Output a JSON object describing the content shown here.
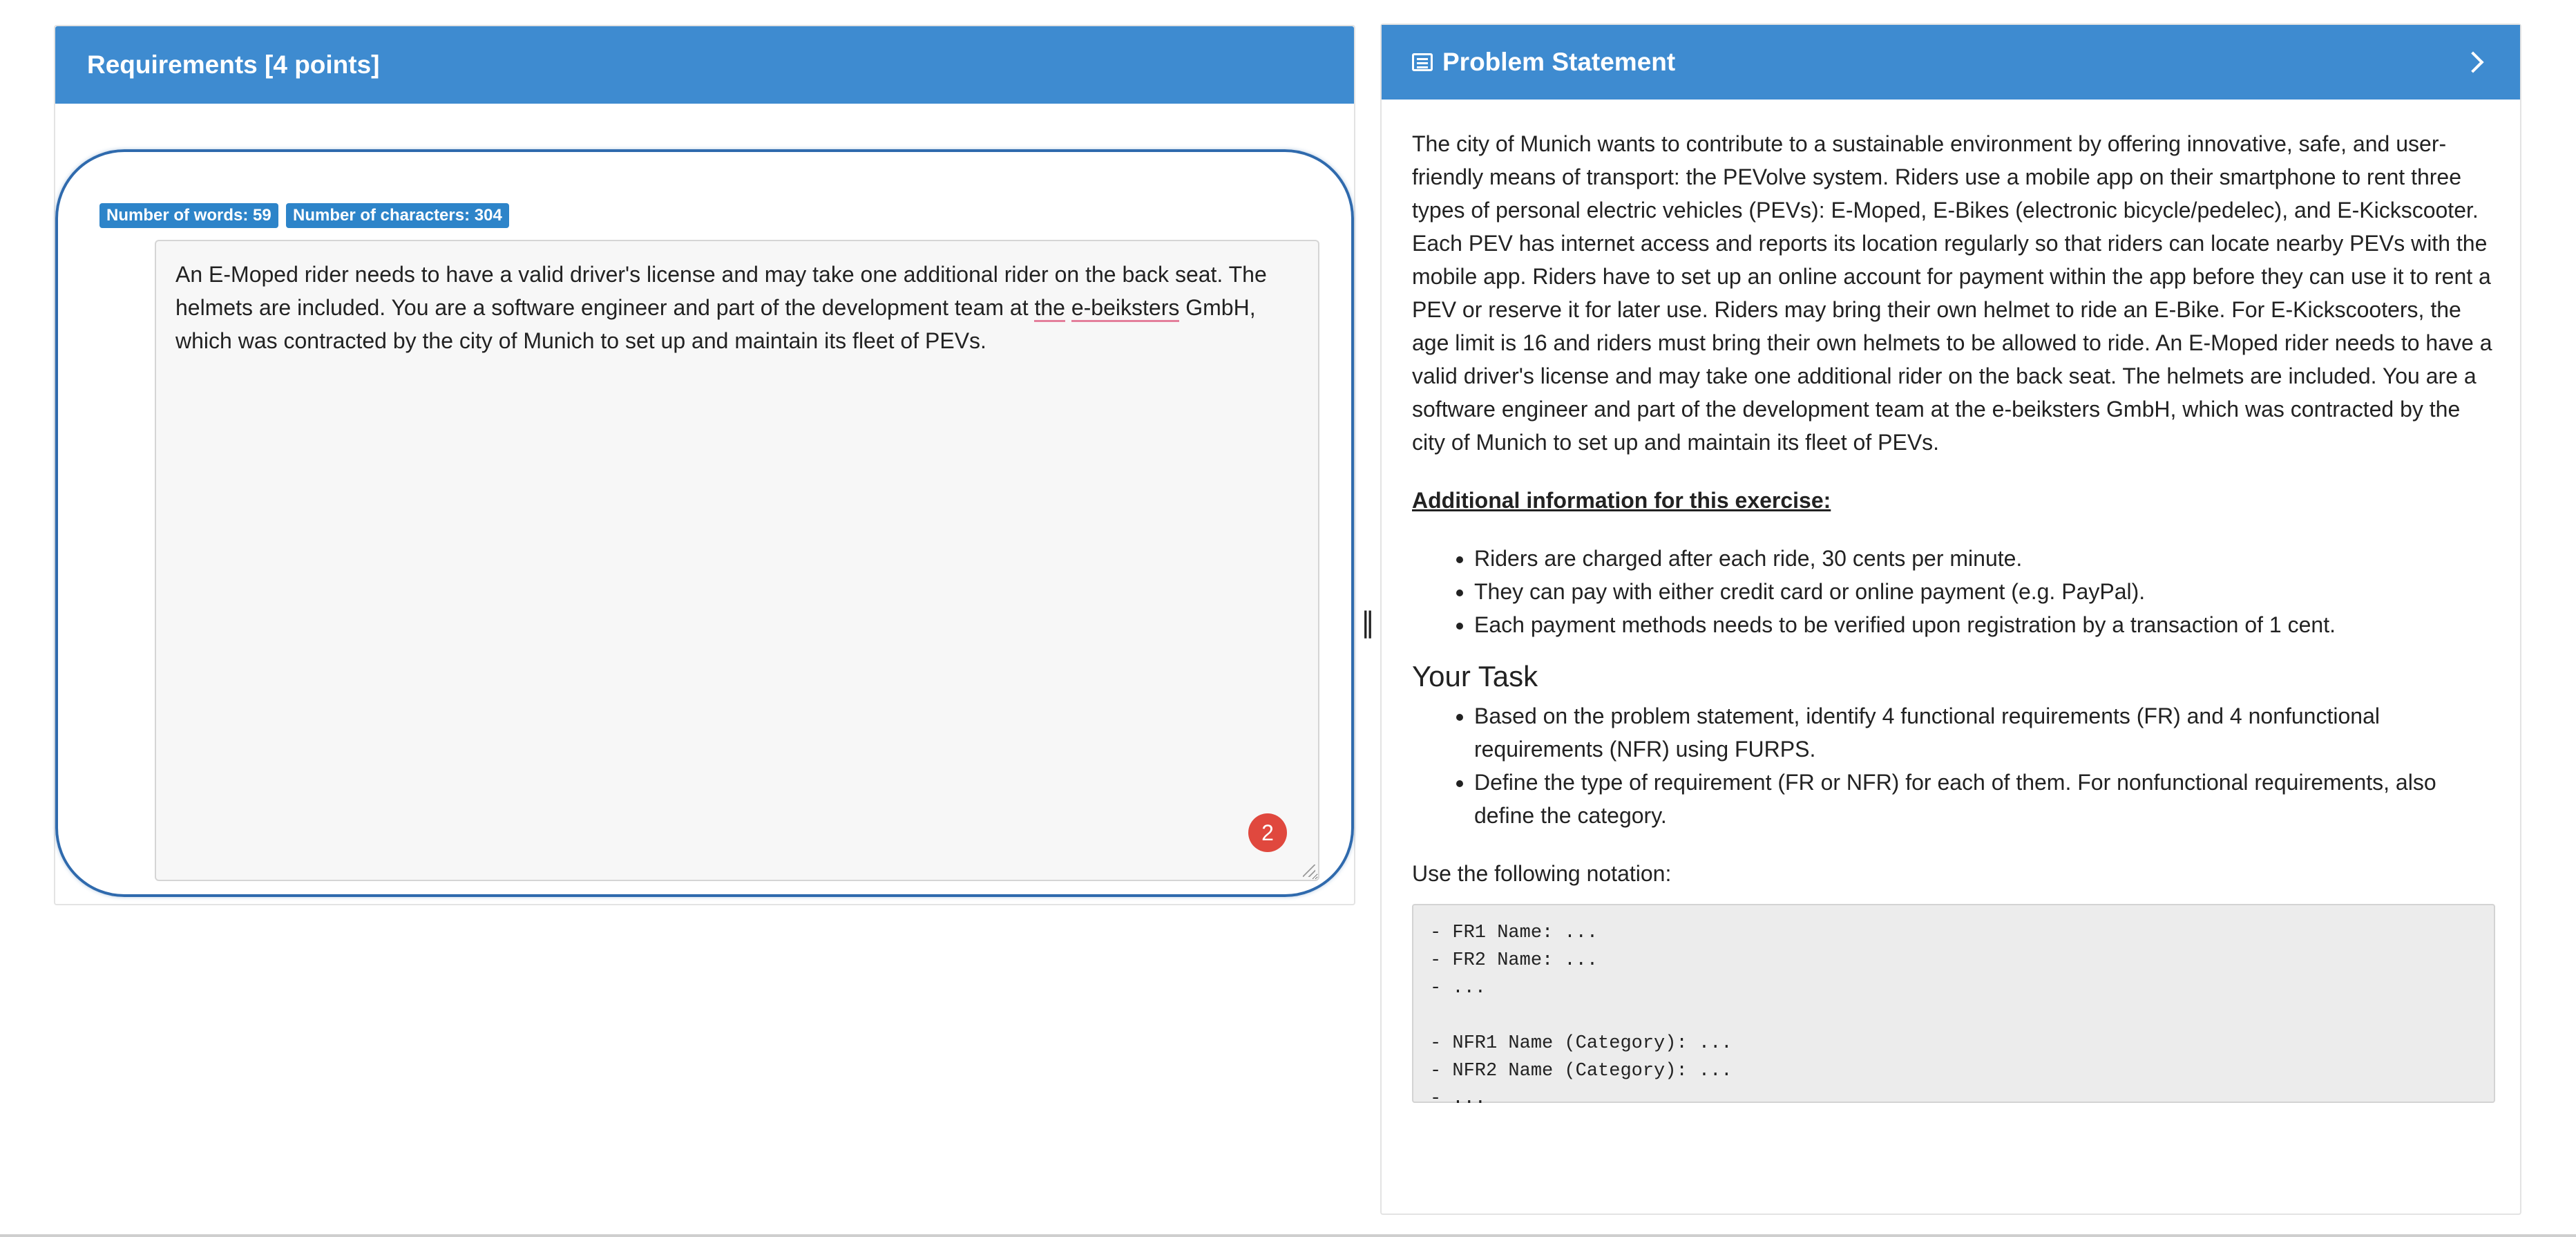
{
  "left_panel": {
    "title": "Requirements [4 points]",
    "word_count_badge": "Number of words: 59",
    "char_count_badge": "Number of characters: 304",
    "answer_text_parts": [
      "An E-Moped rider needs to have a valid driver's license and may take one additional rider on the back seat. The helmets are included. You are a software engineer and part of the development team at ",
      "the",
      " ",
      "e-beiksters",
      " GmbH, which was contracted by the city of Munich to set up and maintain its fleet of PEVs."
    ],
    "counter_badge": "2",
    "splitter_glyph": "‖"
  },
  "right_panel": {
    "title": "Problem Statement",
    "intro": "The city of Munich wants to contribute to a sustainable environment by offering innovative, safe, and user-friendly means of transport: the PEVolve system. Riders use a mobile app on their smartphone to rent three types of personal electric vehicles (PEVs): E-Moped, E-Bikes (electronic bicycle/pedelec), and E-Kickscooter. Each PEV has internet access and reports its location regularly so that riders can locate nearby PEVs with the mobile app. Riders have to set up an online account for payment within the app before they can use it to rent a PEV or reserve it for later use. Riders may bring their own helmet to ride an E-Bike. For E-Kickscooters, the age limit is 16 and riders must bring their own helmets to be allowed to ride. An E-Moped rider needs to have a valid driver's license and may take one additional rider on the back seat. The helmets are included. You are a software engineer and part of the development team at the e-beiksters GmbH, which was contracted by the city of Munich to set up and maintain its fleet of PEVs.",
    "additional_info_heading": "Additional information for this exercise:",
    "additional_info": [
      "Riders are charged after each ride, 30 cents per minute.",
      "They can pay with either credit card or online payment (e.g. PayPal).",
      "Each payment methods needs to be verified upon registration by a transaction of 1 cent."
    ],
    "task_heading": "Your Task",
    "tasks": [
      "Based on the problem statement, identify 4 functional requirements (FR) and 4 nonfunctional requirements (NFR) using FURPS.",
      "Define the type of requirement (FR or NFR) for each of them. For nonfunctional requirements, also define the category."
    ],
    "notation_intro": "Use the following notation:",
    "notation_code": "- FR1 Name: ...\n- FR2 Name: ...\n- ...\n\n- NFR1 Name (Category): ...\n- NFR2 Name (Category): ...\n- ..."
  },
  "colors": {
    "header_blue": "#3e8bd0",
    "badge_blue": "#2d84c9",
    "focus_ring": "#2f6aad",
    "counter_red": "#e0483e"
  },
  "icons": {
    "problem_statement": "list-alt-icon",
    "collapse": "chevron-right-icon",
    "splitter": "resize-handle-icon"
  }
}
